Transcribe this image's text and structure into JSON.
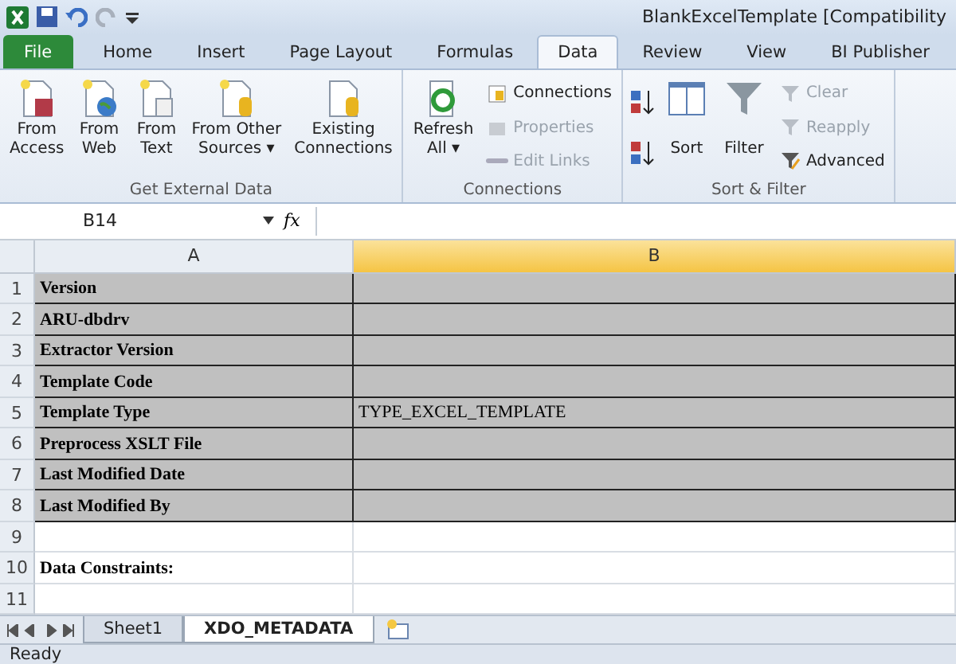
{
  "window": {
    "title": "BlankExcelTemplate  [Compatibility"
  },
  "tabs": [
    {
      "label": "File",
      "kind": "file",
      "selected": false
    },
    {
      "label": "Home",
      "kind": "tab",
      "selected": false
    },
    {
      "label": "Insert",
      "kind": "tab",
      "selected": false
    },
    {
      "label": "Page Layout",
      "kind": "tab",
      "selected": false
    },
    {
      "label": "Formulas",
      "kind": "tab",
      "selected": false
    },
    {
      "label": "Data",
      "kind": "tab",
      "selected": true
    },
    {
      "label": "Review",
      "kind": "tab",
      "selected": false
    },
    {
      "label": "View",
      "kind": "tab",
      "selected": false
    },
    {
      "label": "BI Publisher",
      "kind": "tab",
      "selected": false
    }
  ],
  "ribbon_groups": [
    {
      "label": "Get External Data",
      "items": [
        {
          "kind": "large",
          "lines": [
            "From",
            "Access"
          ]
        },
        {
          "kind": "large",
          "lines": [
            "From",
            "Web"
          ]
        },
        {
          "kind": "large",
          "lines": [
            "From",
            "Text"
          ]
        },
        {
          "kind": "large",
          "lines": [
            "From Other",
            "Sources ▾"
          ]
        },
        {
          "kind": "large",
          "lines": [
            "Existing",
            "Connections"
          ]
        }
      ]
    },
    {
      "label": "Connections",
      "items": [
        {
          "kind": "large",
          "lines": [
            "Refresh",
            "All ▾"
          ]
        },
        {
          "kind": "stack",
          "buttons": [
            {
              "label": "Connections",
              "disabled": false
            },
            {
              "label": "Properties",
              "disabled": true
            },
            {
              "label": "Edit Links",
              "disabled": true
            }
          ]
        }
      ]
    },
    {
      "label": "Sort & Filter",
      "items": [
        {
          "kind": "sortpair"
        },
        {
          "kind": "large",
          "lines": [
            "Sort"
          ]
        },
        {
          "kind": "large",
          "lines": [
            "Filter"
          ]
        },
        {
          "kind": "stack",
          "buttons": [
            {
              "label": "Clear",
              "disabled": true
            },
            {
              "label": "Reapply",
              "disabled": true
            },
            {
              "label": "Advanced",
              "disabled": false
            }
          ]
        }
      ]
    }
  ],
  "formula_bar": {
    "name_box": "B14",
    "fx": "fx"
  },
  "columns": [
    {
      "label": "A",
      "selected": false
    },
    {
      "label": "B",
      "selected": true
    }
  ],
  "rows": [
    {
      "number": "1",
      "a": "Version",
      "shaded": true
    },
    {
      "number": "2",
      "a": "ARU-dbdrv",
      "shaded": true
    },
    {
      "number": "3",
      "a": "Extractor Version",
      "shaded": true
    },
    {
      "number": "4",
      "a": "Template Code",
      "shaded": true
    },
    {
      "number": "5",
      "a": "Template Type",
      "b": "TYPE_EXCEL_TEMPLATE",
      "shaded": true
    },
    {
      "number": "6",
      "a": "Preprocess XSLT File",
      "shaded": true
    },
    {
      "number": "7",
      "a": "Last Modified Date",
      "shaded": true
    },
    {
      "number": "8",
      "a": "Last Modified By",
      "shaded": true
    },
    {
      "number": "9",
      "shaded": false
    },
    {
      "number": "10",
      "a": "Data Constraints:",
      "shaded": false
    },
    {
      "number": "11",
      "shaded": false
    }
  ],
  "sheet_tabs": [
    {
      "label": "Sheet1",
      "selected": false
    },
    {
      "label": "XDO_METADATA",
      "selected": true
    }
  ],
  "status_bar": {
    "text": "Ready"
  }
}
